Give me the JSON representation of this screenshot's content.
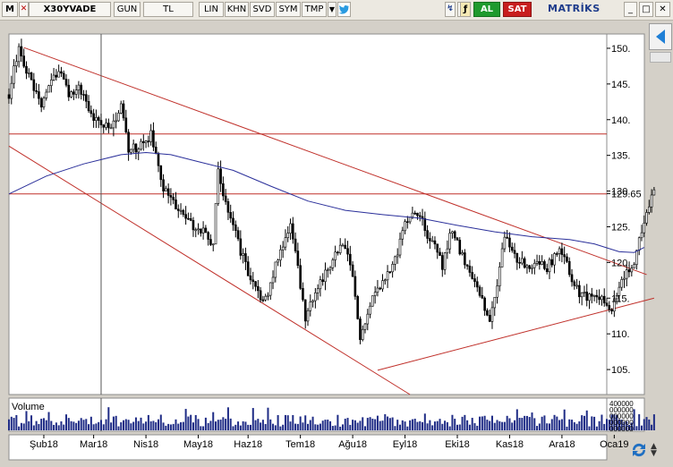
{
  "toolbar": {
    "m_label": "M",
    "symbol": "X30YVADE",
    "period": "GUN",
    "currency": "TL",
    "scale": "LIN",
    "btn_khn": "KHN",
    "btn_svd": "SVD",
    "btn_sym": "SYM",
    "btn_tmp": "TMP",
    "buy_label": "AL",
    "sell_label": "SAT",
    "brand": "MATRİKS",
    "colors": {
      "buy": "#1f9a2e",
      "sell": "#c81e1e",
      "brand": "#1d3b8b"
    }
  },
  "chart_data": {
    "type": "candlestick",
    "xlim": [
      0,
      240
    ],
    "ylim": [
      101.5,
      152
    ],
    "y_ticks": [
      105,
      110,
      115,
      120,
      125,
      130,
      135,
      140,
      145,
      150
    ],
    "price_label": "129.65",
    "x_tick_labels": [
      {
        "label": "Şub18",
        "x": 14
      },
      {
        "label": "Mar18",
        "x": 34
      },
      {
        "label": "Nis18",
        "x": 55
      },
      {
        "label": "May18",
        "x": 76
      },
      {
        "label": "Haz18",
        "x": 96
      },
      {
        "label": "Tem18",
        "x": 117
      },
      {
        "label": "Ağu18",
        "x": 138
      },
      {
        "label": "Eyl18",
        "x": 159
      },
      {
        "label": "Eki18",
        "x": 180
      },
      {
        "label": "Kas18",
        "x": 201
      },
      {
        "label": "Ara18",
        "x": 222
      },
      {
        "label": "Oca19",
        "x": 243
      }
    ],
    "price_points": [
      [
        0,
        143.5
      ],
      [
        4,
        150.2
      ],
      [
        8,
        146
      ],
      [
        13,
        141.5
      ],
      [
        16,
        145.2
      ],
      [
        20,
        146.8
      ],
      [
        24,
        143.4
      ],
      [
        28,
        144.8
      ],
      [
        32,
        141
      ],
      [
        37,
        139.7
      ],
      [
        41,
        138.5
      ],
      [
        45,
        141.6
      ],
      [
        48,
        135.8
      ],
      [
        53,
        136.4
      ],
      [
        57,
        137.8
      ],
      [
        62,
        130.3
      ],
      [
        67,
        127.9
      ],
      [
        71,
        126.2
      ],
      [
        74,
        124.8
      ],
      [
        78,
        124.5
      ],
      [
        82,
        122.7
      ],
      [
        84,
        133
      ],
      [
        87,
        128.4
      ],
      [
        90,
        125.5
      ],
      [
        93,
        121.6
      ],
      [
        96,
        118.8
      ],
      [
        99,
        116.7
      ],
      [
        102,
        114.6
      ],
      [
        105,
        116.8
      ],
      [
        107,
        120.2
      ],
      [
        111,
        122.8
      ],
      [
        113,
        125.3
      ],
      [
        117,
        116.9
      ],
      [
        119,
        111.5
      ],
      [
        123,
        116.2
      ],
      [
        127,
        118.3
      ],
      [
        131,
        121.2
      ],
      [
        135,
        122.6
      ],
      [
        138,
        118.1
      ],
      [
        141,
        108.7
      ],
      [
        142,
        110.5
      ],
      [
        146,
        115.1
      ],
      [
        150,
        117.6
      ],
      [
        153,
        119.1
      ],
      [
        156,
        121.4
      ],
      [
        158,
        124.6
      ],
      [
        162,
        127.6
      ],
      [
        165,
        126.8
      ],
      [
        168,
        123.1
      ],
      [
        171,
        122.4
      ],
      [
        174,
        119.3
      ],
      [
        178,
        124.9
      ],
      [
        181,
        121.6
      ],
      [
        185,
        118.7
      ],
      [
        188,
        116.9
      ],
      [
        191,
        113.2
      ],
      [
        193,
        111.8
      ],
      [
        196,
        117.1
      ],
      [
        199,
        123.6
      ],
      [
        202,
        121.8
      ],
      [
        205,
        120.1
      ],
      [
        209,
        119.3
      ],
      [
        212,
        120.8
      ],
      [
        216,
        119.2
      ],
      [
        219,
        120.9
      ],
      [
        222,
        121.7
      ],
      [
        226,
        117.4
      ],
      [
        229,
        115.6
      ],
      [
        233,
        114.9
      ],
      [
        236,
        115.2
      ],
      [
        239,
        114.4
      ],
      [
        242,
        113.7
      ],
      [
        245,
        116.1
      ],
      [
        248,
        118.7
      ],
      [
        251,
        120.3
      ],
      [
        254,
        124.6
      ],
      [
        257,
        128.1
      ],
      [
        259,
        129.65
      ]
    ],
    "moving_average": [
      [
        0,
        129.6
      ],
      [
        15,
        132.1
      ],
      [
        30,
        133.8
      ],
      [
        45,
        135.1
      ],
      [
        55,
        135.4
      ],
      [
        65,
        135.1
      ],
      [
        75,
        134.2
      ],
      [
        90,
        132.9
      ],
      [
        105,
        130.7
      ],
      [
        120,
        128.6
      ],
      [
        135,
        127.3
      ],
      [
        150,
        126.7
      ],
      [
        165,
        126.2
      ],
      [
        180,
        125.2
      ],
      [
        195,
        124.3
      ],
      [
        210,
        123.6
      ],
      [
        225,
        123.2
      ],
      [
        235,
        122.6
      ],
      [
        245,
        121.5
      ],
      [
        251,
        121.4
      ],
      [
        255,
        122.1
      ]
    ],
    "trendlines": [
      {
        "points": [
          [
            6,
            150.1
          ],
          [
            256,
            118.3
          ]
        ]
      },
      {
        "points": [
          [
            0,
            136.3
          ],
          [
            161,
            101.5
          ]
        ]
      },
      {
        "points": [
          [
            148,
            104.9
          ],
          [
            259,
            115
          ]
        ]
      }
    ],
    "horizontal_lines": [
      138,
      129.6
    ],
    "crosshair_x": 37,
    "volume": {
      "label": "Volume",
      "axis_labels": [
        "400000",
        "000000",
        "000000",
        "000000",
        "000000"
      ],
      "seed": 73
    }
  },
  "icons": {
    "twitter": "twitter-icon",
    "lightning": "lightning-icon",
    "refresh": "refresh-icon",
    "back_arrow": "back-arrow-icon"
  }
}
